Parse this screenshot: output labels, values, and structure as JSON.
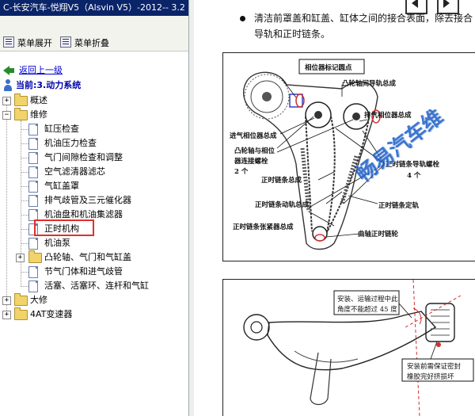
{
  "window": {
    "title": "C-长安汽车-悦翔V5（Alsvin V5）-2012-- 3.2"
  },
  "toolbar": {
    "expand_label": "菜单展开",
    "collapse_label": "菜单折叠"
  },
  "tree": {
    "back_label": "返回上一级",
    "current_label": "当前:3.动力系统",
    "items": [
      {
        "label": "概述"
      },
      {
        "label": "维修"
      },
      {
        "label": "缸压检查"
      },
      {
        "label": "机油压力检查"
      },
      {
        "label": "气门间隙检查和调整"
      },
      {
        "label": "空气滤清器滤芯"
      },
      {
        "label": "气缸盖罩"
      },
      {
        "label": "排气歧管及三元催化器"
      },
      {
        "label": "机油盘和机油集滤器"
      },
      {
        "label": "正时机构"
      },
      {
        "label": "机油泵"
      },
      {
        "label": "凸轮轴、气门和气缸盖"
      },
      {
        "label": "节气门体和进气歧管"
      },
      {
        "label": "活塞、活塞环、连杆和气缸"
      },
      {
        "label": "大修"
      },
      {
        "label": "4AT变速器"
      }
    ]
  },
  "document": {
    "line1": "清洁前罩盖和缸盖、缸体之间的接合表面，除去接合",
    "line2": "导轨和正时链条。",
    "watermark": "畅易汽车维",
    "figure1": {
      "labels": {
        "phase_mark": "相位器标记圆点",
        "cam_guide": "凸轮轴间导轨总成",
        "exhaust_phase": "排气相位器总成",
        "intake_phase": "进气相位器总成",
        "cam_bolt_1": "凸轮轴与相位",
        "cam_bolt_2": "器连接螺栓",
        "cam_bolt_3": "2 个",
        "chain_bolt_1": "正时链条导轨螺栓",
        "chain_bolt_2": "4 个",
        "chain_assy": "正时链条总成",
        "moving_rail": "正时链条动轨总成",
        "fixed_rail": "正时链条定轨",
        "tensioner": "正时链条张紧器总成",
        "crank_sprocket": "曲轴正时链轮"
      }
    },
    "figure2": {
      "note1_a": "安装、运输过程中此",
      "note1_b": "角度不能超过 45 度",
      "note2_a": "安装前需保证密封",
      "note2_b": "橡胶完好挤损坏"
    }
  },
  "colors": {
    "titlebar": "#0a246a",
    "selection": "#e0302c",
    "watermark": "#1e5fc4"
  }
}
